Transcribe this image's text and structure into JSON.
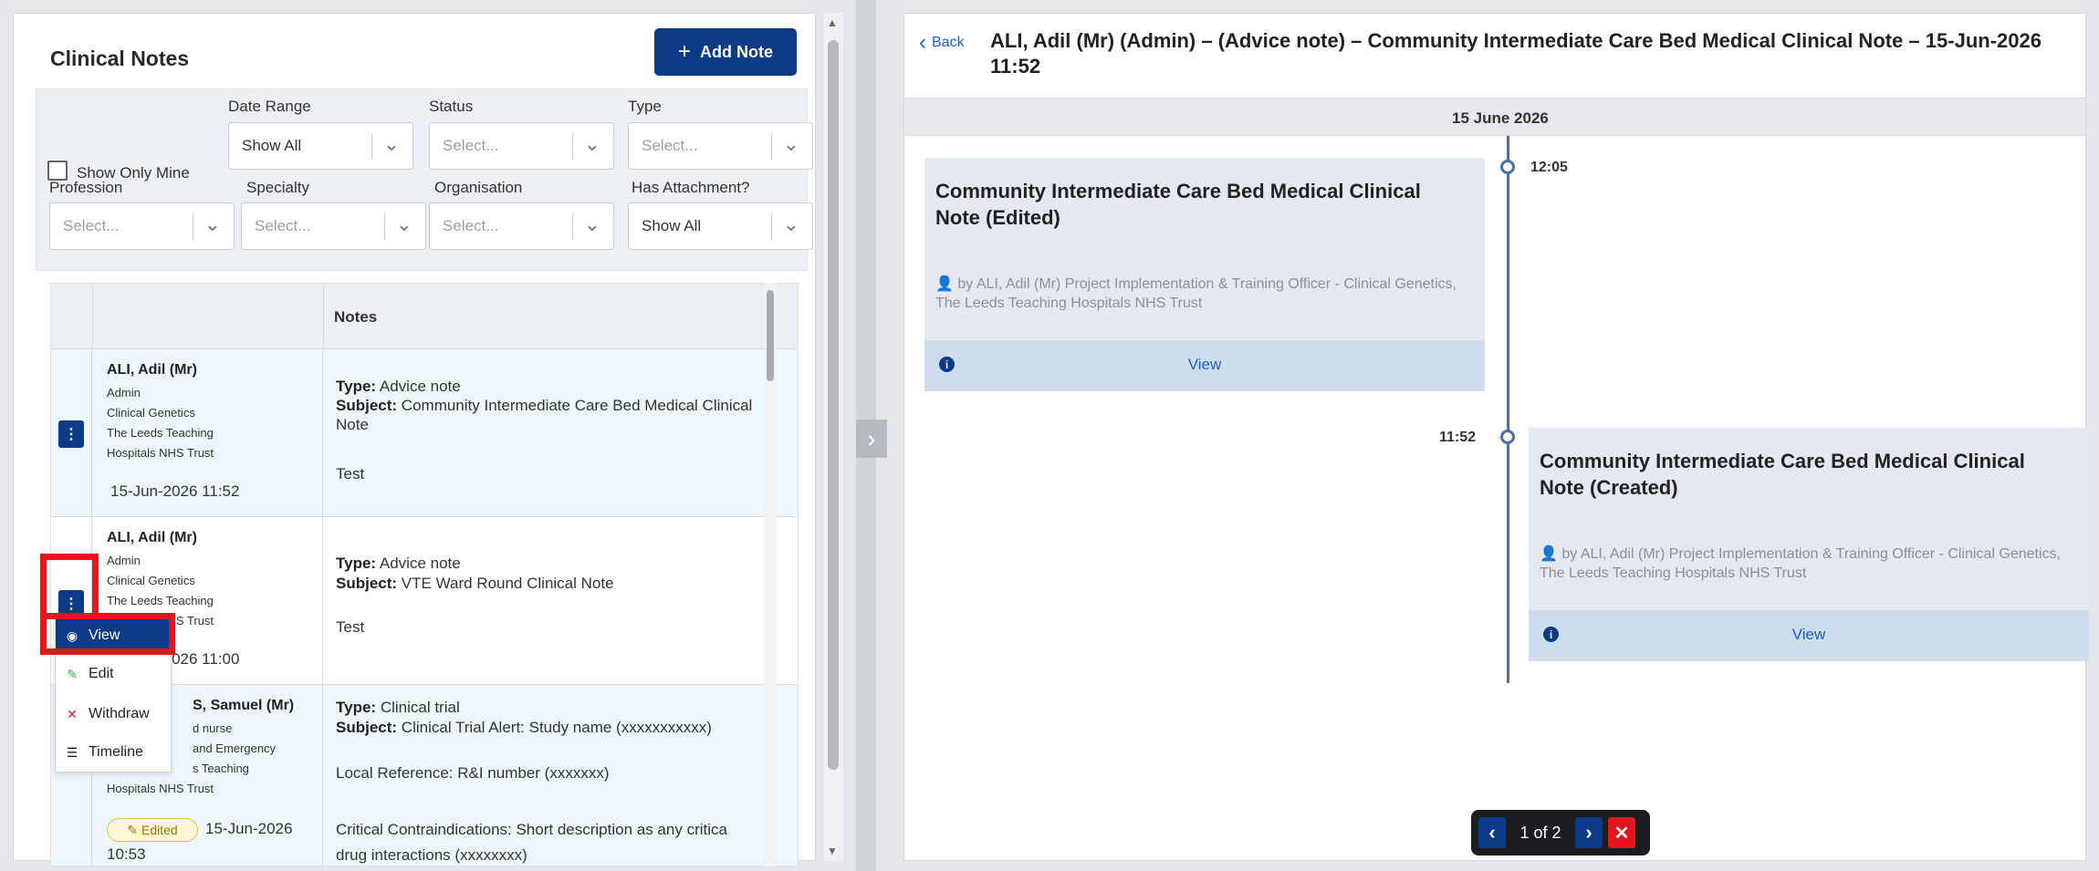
{
  "left": {
    "title": "Clinical Notes",
    "add_note_label": "Add Note",
    "filters": {
      "show_only_mine": "Show Only Mine",
      "date_range": {
        "label": "Date Range",
        "value": "Show All"
      },
      "status": {
        "label": "Status",
        "value": "Select..."
      },
      "type": {
        "label": "Type",
        "value": "Select..."
      },
      "profession": {
        "label": "Profession",
        "value": "Select..."
      },
      "specialty": {
        "label": "Specialty",
        "value": "Select..."
      },
      "organisation": {
        "label": "Organisation",
        "value": "Select..."
      },
      "has_attachment": {
        "label": "Has Attachment?",
        "value": "Show All"
      }
    },
    "table": {
      "notes_header": "Notes",
      "rows": [
        {
          "name": "ALI, Adil (Mr)",
          "role": "Admin",
          "specialty": "Clinical Genetics",
          "org_line1": "The Leeds Teaching",
          "org_line2": "Hospitals NHS Trust",
          "timestamp": "15-Jun-2026 11:52",
          "type_label": "Type:",
          "type": "Advice note",
          "subject_label": "Subject:",
          "subject": "Community Intermediate Care Bed Medical Clinical Note",
          "body": "Test"
        },
        {
          "name": "ALI, Adil (Mr)",
          "role": "Admin",
          "specialty": "Clinical Genetics",
          "org_line1": "The Leeds Teaching",
          "org_line2": "Hospitals NHS Trust",
          "timestamp": "15-Jun-2026 11:00",
          "type_label": "Type:",
          "type": "Advice note",
          "subject_label": "Subject:",
          "subject": "VTE Ward Round Clinical Note",
          "body": "Test"
        },
        {
          "name": "S, Samuel (Mr)",
          "role": "d nurse",
          "specialty": "and Emergency",
          "org_line1": "s Teaching",
          "org_line2": "Hospitals NHS Trust",
          "badge": "Edited",
          "timestamp_a": "15-Jun-2026",
          "timestamp_b": "10:53",
          "type_label": "Type:",
          "type": "Clinical trial",
          "subject_label": "Subject:",
          "subject": "Clinical Trial Alert: Study name (xxxxxxxxxxx)",
          "body1": "Local Reference: R&I number (xxxxxxx)",
          "body2": "Critical Contraindications: Short description as any critica",
          "body3": "drug interactions (xxxxxxxx)"
        }
      ]
    },
    "menu": {
      "view": "View",
      "edit": "Edit",
      "withdraw": "Withdraw",
      "timeline": "Timeline"
    }
  },
  "right": {
    "back_label": "Back",
    "title": "ALI, Adil (Mr) (Admin) – (Advice note) – Community Intermediate Care Bed Medical Clinical Note – 15-Jun-2026 11:52",
    "date_header": "15 June 2026",
    "entries": [
      {
        "time": "12:05",
        "title": "Community Intermediate Care Bed Medical Clinical Note (Edited)",
        "by": "by ALI, Adil (Mr) Project Implementation & Training Officer - Clinical Genetics, The Leeds Teaching Hospitals NHS Trust",
        "view_label": "View"
      },
      {
        "time": "11:52",
        "title": "Community Intermediate Care Bed Medical Clinical Note (Created)",
        "by": "by ALI, Adil (Mr) Project Implementation & Training Officer - Clinical Genetics, The Leeds Teaching Hospitals NHS Trust",
        "view_label": "View"
      }
    ],
    "pager": {
      "count": "1 of 2"
    }
  },
  "colors": {
    "primary": "#0b3a87",
    "highlight": "#e4161c",
    "link": "#1c5fc7"
  }
}
